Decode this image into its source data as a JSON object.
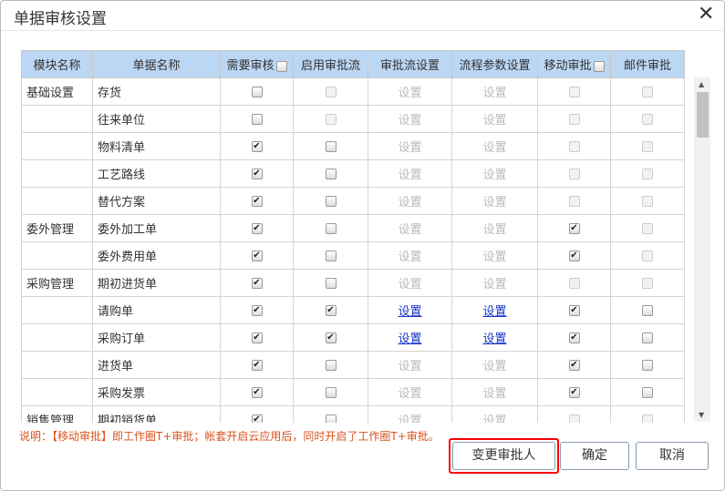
{
  "dialog": {
    "title": "单据审核设置",
    "close_icon": "close-icon"
  },
  "headers": [
    "模块名称",
    "单据名称",
    "需要审核",
    "启用审批流",
    "审批流设置",
    "流程参数设置",
    "移动审批",
    "邮件审批"
  ],
  "link_label": "设置",
  "rows": [
    {
      "module": "基础设置",
      "doc": "存货",
      "need": [
        false,
        true
      ],
      "enable": [
        false,
        false
      ],
      "links": false,
      "mobile": [
        false,
        false
      ],
      "mail": [
        false,
        false
      ]
    },
    {
      "module": "",
      "doc": "往来单位",
      "need": [
        false,
        true
      ],
      "enable": [
        false,
        false
      ],
      "links": false,
      "mobile": [
        false,
        false
      ],
      "mail": [
        false,
        false
      ]
    },
    {
      "module": "",
      "doc": "物料清单",
      "need": [
        true,
        true
      ],
      "enable": [
        false,
        true
      ],
      "links": false,
      "mobile": [
        false,
        false
      ],
      "mail": [
        false,
        false
      ]
    },
    {
      "module": "",
      "doc": "工艺路线",
      "need": [
        true,
        true
      ],
      "enable": [
        false,
        true
      ],
      "links": false,
      "mobile": [
        false,
        false
      ],
      "mail": [
        false,
        false
      ]
    },
    {
      "module": "",
      "doc": "替代方案",
      "need": [
        true,
        true
      ],
      "enable": [
        false,
        true
      ],
      "links": false,
      "mobile": [
        false,
        false
      ],
      "mail": [
        false,
        false
      ]
    },
    {
      "module": "委外管理",
      "doc": "委外加工单",
      "need": [
        true,
        true
      ],
      "enable": [
        false,
        true
      ],
      "links": false,
      "mobile": [
        true,
        true
      ],
      "mail": [
        false,
        false
      ]
    },
    {
      "module": "",
      "doc": "委外费用单",
      "need": [
        true,
        true
      ],
      "enable": [
        false,
        true
      ],
      "links": false,
      "mobile": [
        true,
        true
      ],
      "mail": [
        false,
        false
      ]
    },
    {
      "module": "采购管理",
      "doc": "期初进货单",
      "need": [
        true,
        true
      ],
      "enable": [
        false,
        true
      ],
      "links": false,
      "mobile": [
        false,
        false
      ],
      "mail": [
        false,
        false
      ]
    },
    {
      "module": "",
      "doc": "请购单",
      "need": [
        true,
        true
      ],
      "enable": [
        true,
        true
      ],
      "links": true,
      "mobile": [
        true,
        true
      ],
      "mail": [
        false,
        true
      ]
    },
    {
      "module": "",
      "doc": "采购订单",
      "need": [
        true,
        true
      ],
      "enable": [
        true,
        true
      ],
      "links": true,
      "mobile": [
        true,
        true
      ],
      "mail": [
        false,
        true
      ]
    },
    {
      "module": "",
      "doc": "进货单",
      "need": [
        true,
        true
      ],
      "enable": [
        false,
        true
      ],
      "links": false,
      "mobile": [
        true,
        true
      ],
      "mail": [
        false,
        true
      ]
    },
    {
      "module": "",
      "doc": "采购发票",
      "need": [
        true,
        true
      ],
      "enable": [
        false,
        true
      ],
      "links": false,
      "mobile": [
        true,
        true
      ],
      "mail": [
        false,
        true
      ]
    },
    {
      "module": "销售管理",
      "doc": "期初销货单",
      "need": [
        true,
        true
      ],
      "enable": [
        false,
        true
      ],
      "links": false,
      "mobile": [
        false,
        false
      ],
      "mail": [
        false,
        false
      ]
    }
  ],
  "note": "说明：【移动审批】即工作圈T+审批；帐套开启云应用后，同时开启了工作圈T+审批。",
  "buttons": {
    "change": "变更审批人",
    "ok": "确定",
    "cancel": "取消"
  },
  "colors": {
    "header_bg": "#bcd7f4",
    "note": "#d9531e",
    "highlight": "#ff0000",
    "link": "#1a35cc"
  }
}
